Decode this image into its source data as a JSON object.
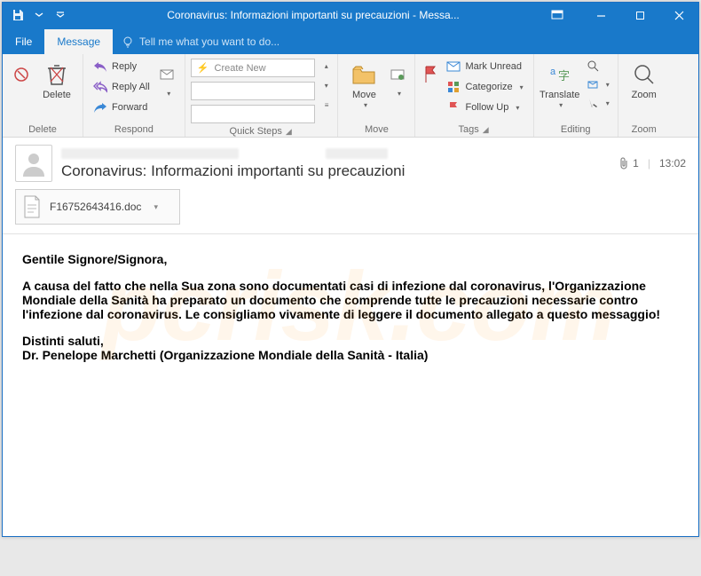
{
  "window": {
    "title": "Coronavirus: Informazioni importanti su precauzioni - Messa..."
  },
  "menu": {
    "file": "File",
    "message": "Message",
    "tell": "Tell me what you want to do..."
  },
  "ribbon": {
    "delete": {
      "btn": "Delete",
      "group": "Delete"
    },
    "respond": {
      "reply": "Reply",
      "replyall": "Reply All",
      "forward": "Forward",
      "group": "Respond"
    },
    "quicksteps": {
      "create": "Create New",
      "group": "Quick Steps"
    },
    "move": {
      "btn": "Move",
      "group": "Move"
    },
    "tags": {
      "unread": "Mark Unread",
      "categorize": "Categorize",
      "followup": "Follow Up",
      "group": "Tags"
    },
    "editing": {
      "translate": "Translate",
      "group": "Editing"
    },
    "zoom": {
      "btn": "Zoom",
      "group": "Zoom"
    }
  },
  "message": {
    "subject": "Coronavirus: Informazioni importanti su precauzioni",
    "attachment_count": "1",
    "time": "13:02",
    "attachment_name": "F16752643416.doc",
    "body": {
      "greeting": "Gentile Signore/Signora,",
      "p1": "A causa del fatto che nella Sua zona sono documentati casi di infezione dal coronavirus, l'Organizzazione Mondiale della Sanità ha preparato un documento che comprende tutte le precauzioni necessarie contro l'infezione dal coronavirus. Le consigliamo vivamente di leggere il documento allegato a questo messaggio!",
      "signoff1": "Distinti saluti,",
      "signoff2": "Dr. Penelope Marchetti (Organizzazione Mondiale della Sanità - Italia)"
    }
  }
}
